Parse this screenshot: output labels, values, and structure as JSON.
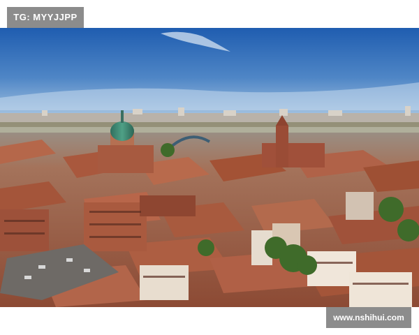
{
  "badge": {
    "text": "TG: MYYJJPP"
  },
  "watermark": {
    "text": "www.nshihui.com"
  },
  "colors": {
    "sky_top": "#1f5db0",
    "sky_bottom": "#8fb6dc",
    "roof": "#a9583d",
    "brick": "#b2603f",
    "dome": "#3f8d78",
    "badge_bg": "#8c8c8c"
  }
}
